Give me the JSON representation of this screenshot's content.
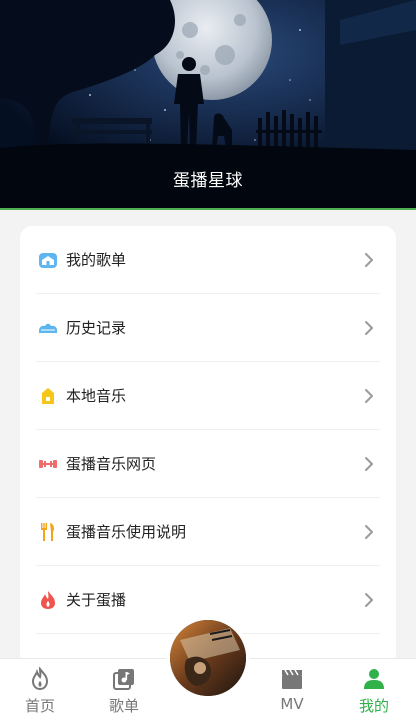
{
  "header": {
    "title": "蛋播星球"
  },
  "menu": {
    "items": [
      {
        "label": "我的歌单",
        "icon": "playlist-icon"
      },
      {
        "label": "历史记录",
        "icon": "history-icon"
      },
      {
        "label": "本地音乐",
        "icon": "local-music-icon"
      },
      {
        "label": "蛋播音乐网页",
        "icon": "web-icon"
      },
      {
        "label": "蛋播音乐使用说明",
        "icon": "instructions-icon"
      },
      {
        "label": "关于蛋播",
        "icon": "about-icon"
      }
    ]
  },
  "nav": {
    "items": [
      {
        "label": "首页",
        "icon": "flame-icon"
      },
      {
        "label": "歌单",
        "icon": "music-list-icon"
      },
      {
        "label": "MV",
        "icon": "clapper-icon"
      },
      {
        "label": "我的",
        "icon": "user-icon"
      }
    ],
    "active": "我的"
  },
  "colors": {
    "accent": "#31b14a",
    "header_bg": "#071a33",
    "page_bg": "#f3f3f3"
  }
}
